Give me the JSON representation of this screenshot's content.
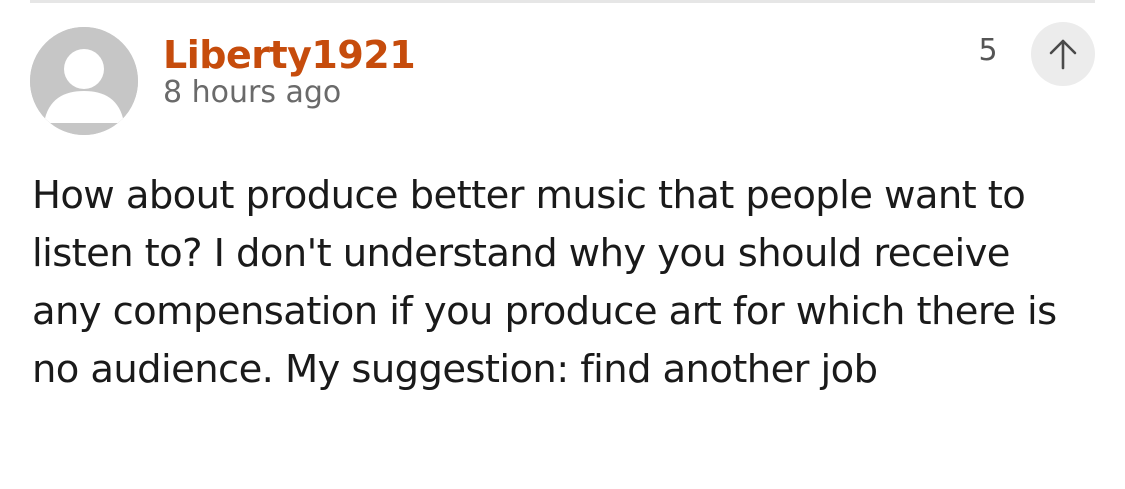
{
  "comment": {
    "author": "Liberty1921",
    "timestamp": "8 hours ago",
    "vote_count": "5",
    "body": "How about produce better music that people want to listen to? I don't understand why you should receive any compensation if you produce art for which there is no audience. My suggestion: find another job"
  },
  "icons": {
    "avatar": "user-silhouette-icon",
    "upvote": "arrow-up-icon"
  },
  "colors": {
    "author": "#c64c0c",
    "timestamp": "#6a6a6a",
    "body_text": "#1a1a1a",
    "avatar_bg": "#c6c6c6",
    "upvote_bg": "#ececec"
  }
}
